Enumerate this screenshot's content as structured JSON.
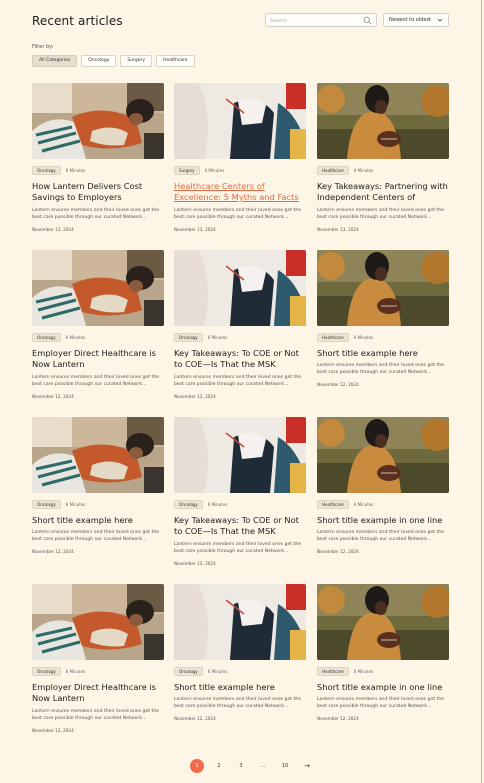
{
  "header": {
    "title": "Recent articles",
    "search_placeholder": "Search",
    "sort_label": "Newest to oldest"
  },
  "filter": {
    "label": "Filter by:",
    "chips": [
      "All Categories",
      "Oncology",
      "Surgery",
      "Healthcare"
    ],
    "active": "All Categories"
  },
  "cards": [
    {
      "tag": "Oncology",
      "minutes": "6 Minutes",
      "title": "How Lantern Delivers Cost Savings to Employers",
      "desc": "Lantern ensures members and their loved ones get the best care possible through our curated Network...",
      "date": "November 13, 2024",
      "image": "couch"
    },
    {
      "tag": "Surgery",
      "minutes": "6 Minutes",
      "title": "Healthcare Centers of Excellence: 5 Myths and Facts B...",
      "desc": "Lantern ensures members and their loved ones get the best care possible through our curated Network...",
      "date": "November 13, 2024",
      "image": "doctor",
      "hovered": true
    },
    {
      "tag": "Healthcare",
      "minutes": "6 Minutes",
      "title": "Key Takeaways: Partnering with Independent Centers of Excelle...",
      "desc": "Lantern ensures members and their loved ones get the best care possible through our curated Network...",
      "date": "November 13, 2024",
      "image": "football"
    },
    {
      "tag": "Oncology",
      "minutes": "6 Minutes",
      "title": "Employer Direct Healthcare is Now Lantern",
      "desc": "Lantern ensures members and their loved ones get the best care possible through our curated Network...",
      "date": "November 12, 2024",
      "image": "couch"
    },
    {
      "tag": "Oncology",
      "minutes": "6 Minutes",
      "title": "Key Takeaways: To COE or Not to COE—Is That the MSK Question?",
      "desc": "Lantern ensures members and their loved ones get the best care possible through our curated Network...",
      "date": "November 12, 2024",
      "image": "doctor"
    },
    {
      "tag": "Healthcare",
      "minutes": "6 Minutes",
      "title": "Short title example here",
      "desc": "Lantern ensures members and their loved ones get the best care possible through our curated Network...",
      "date": "November 12, 2024",
      "image": "football"
    },
    {
      "tag": "Oncology",
      "minutes": "6 Minutes",
      "title": "Short title example here",
      "desc": "Lantern ensures members and their loved ones get the best care possible through our curated Network...",
      "date": "November 12, 2024",
      "image": "couch"
    },
    {
      "tag": "Oncology",
      "minutes": "6 Minutes",
      "title": "Key Takeaways: To COE or Not to COE—Is That the MSK Question?",
      "desc": "Lantern ensures members and their loved ones get the best care possible through our curated Network...",
      "date": "November 12, 2024",
      "image": "doctor"
    },
    {
      "tag": "Healthcare",
      "minutes": "6 Minutes",
      "title": "Short title example in one line",
      "desc": "Lantern ensures members and their loved ones get the best care possible through our curated Network...",
      "date": "November 12, 2024",
      "image": "football"
    },
    {
      "tag": "Oncology",
      "minutes": "6 Minutes",
      "title": "Employer Direct Healthcare is Now Lantern",
      "desc": "Lantern ensures members and their loved ones get the best care possible through our curated Network...",
      "date": "November 12, 2024",
      "image": "couch"
    },
    {
      "tag": "Oncology",
      "minutes": "6 Minutes",
      "title": "Short title example here",
      "desc": "Lantern ensures members and their loved ones get the best care possible through our curated Network...",
      "date": "November 12, 2024",
      "image": "doctor"
    },
    {
      "tag": "Healthcare",
      "minutes": "6 Minutes",
      "title": "Short title example in one line",
      "desc": "Lantern ensures members and their loved ones get the best care possible through our curated Network...",
      "date": "November 12, 2024",
      "image": "football"
    }
  ],
  "pagination": {
    "pages": [
      "1",
      "2",
      "3",
      "...",
      "10"
    ],
    "current": "1",
    "next_icon": "arrow-right-icon"
  },
  "colors": {
    "background": "#fdf6e6",
    "accent": "#f26b4d",
    "link": "#e06a43",
    "tag_bg": "#ece5d4"
  }
}
